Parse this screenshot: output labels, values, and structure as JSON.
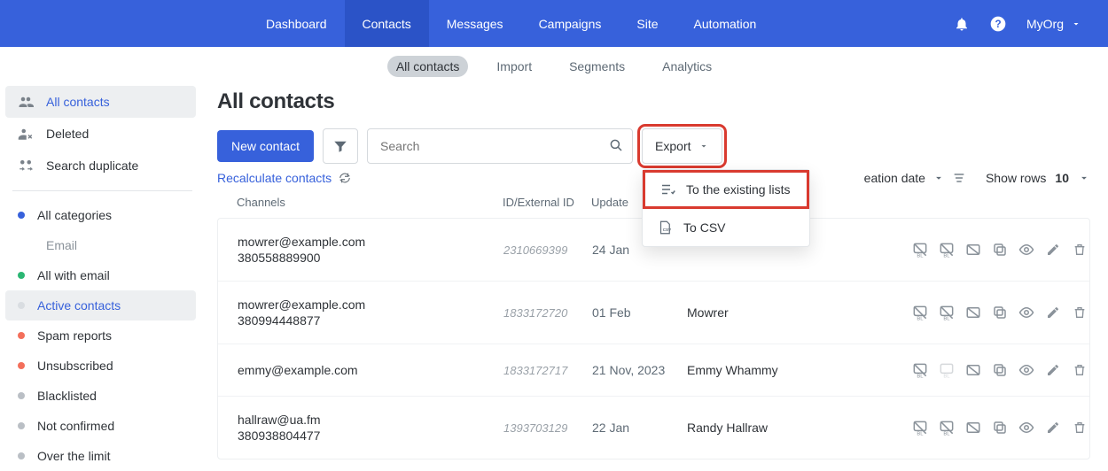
{
  "topnav": {
    "items": [
      "Dashboard",
      "Contacts",
      "Messages",
      "Campaigns",
      "Site",
      "Automation"
    ],
    "active_index": 1,
    "org_label": "MyOrg"
  },
  "subnav": {
    "items": [
      "All contacts",
      "Import",
      "Segments",
      "Analytics"
    ],
    "active_index": 0
  },
  "sidebar": {
    "main": [
      {
        "label": "All contacts",
        "icon": "people",
        "active": true
      },
      {
        "label": "Deleted",
        "icon": "person-x",
        "active": false
      },
      {
        "label": "Search duplicate",
        "icon": "group-swap",
        "active": false
      }
    ],
    "categories": [
      {
        "label": "All categories",
        "color": "#3761db"
      },
      {
        "label": "Email",
        "sub": true
      },
      {
        "label": "All with email",
        "color": "#2bb673"
      },
      {
        "label": "Active contacts",
        "color": "#d9dde1",
        "active": true
      },
      {
        "label": "Spam reports",
        "color": "#f36f5b"
      },
      {
        "label": "Unsubscribed",
        "color": "#f36f5b"
      },
      {
        "label": "Blacklisted",
        "color": "#babfc5"
      },
      {
        "label": "Not confirmed",
        "color": "#babfc5"
      },
      {
        "label": "Over the limit",
        "color": "#babfc5"
      }
    ]
  },
  "main": {
    "title": "All contacts",
    "new_contact_btn": "New contact",
    "search_placeholder": "Search",
    "export_label": "Export",
    "export_menu": {
      "existing": "To the existing lists",
      "csv": "To CSV"
    },
    "recalc_label": "Recalculate contacts",
    "creation_date_label": "eation date",
    "show_rows_label": "Show rows",
    "show_rows_value": "10",
    "columns": {
      "channels": "Channels",
      "id": "ID/External ID",
      "update": "Update"
    },
    "rows": [
      {
        "email": "mowrer@example.com",
        "phone": "380558889900",
        "id": "2310669399",
        "update": "24 Jan",
        "name": ""
      },
      {
        "email": "mowrer@example.com",
        "phone": "380994448877",
        "id": "1833172720",
        "update": "01 Feb",
        "name": "Mowrer"
      },
      {
        "email": "emmy@example.com",
        "phone": "",
        "id": "1833172717",
        "update": "21 Nov, 2023",
        "name": "Emmy Whammy"
      },
      {
        "email": "hallraw@ua.fm",
        "phone": "380938804477",
        "id": "1393703129",
        "update": "22 Jan",
        "name": "Randy Hallraw"
      }
    ]
  }
}
